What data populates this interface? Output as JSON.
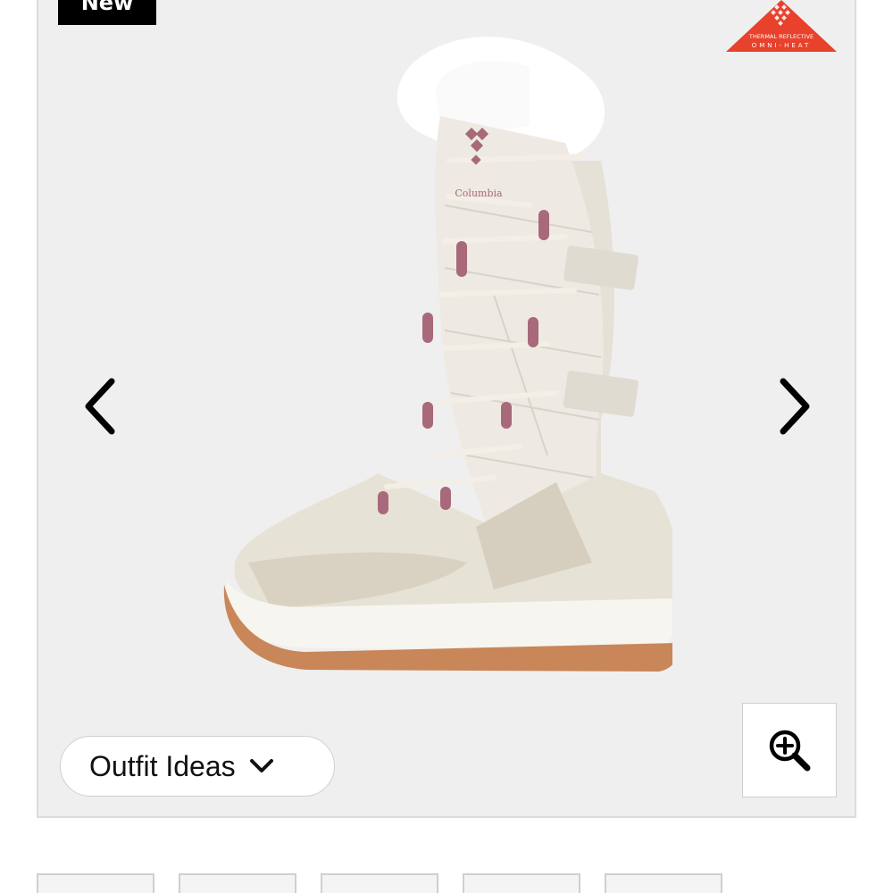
{
  "badge": {
    "label": "New"
  },
  "omni_heat": {
    "line1": "THERMAL REFLECTIVE",
    "line2": "OMNI-HEAT",
    "color": "#e8412c"
  },
  "product": {
    "brand_logo_text": "Columbia",
    "image_icon": "boot-image"
  },
  "nav": {
    "prev_icon": "chevron-left-icon",
    "next_icon": "chevron-right-icon"
  },
  "outfit": {
    "label": "Outfit Ideas"
  },
  "zoom": {
    "icon": "zoom-in-icon"
  },
  "thumbnails": [
    {
      "name": "thumbnail-1"
    },
    {
      "name": "thumbnail-2"
    },
    {
      "name": "thumbnail-3"
    },
    {
      "name": "thumbnail-4"
    },
    {
      "name": "thumbnail-5"
    }
  ],
  "colors": {
    "gallery_bg": "#efefef",
    "boot_body": "#ece8df",
    "lace_accent": "#a8697a",
    "sole": "#c98658"
  }
}
